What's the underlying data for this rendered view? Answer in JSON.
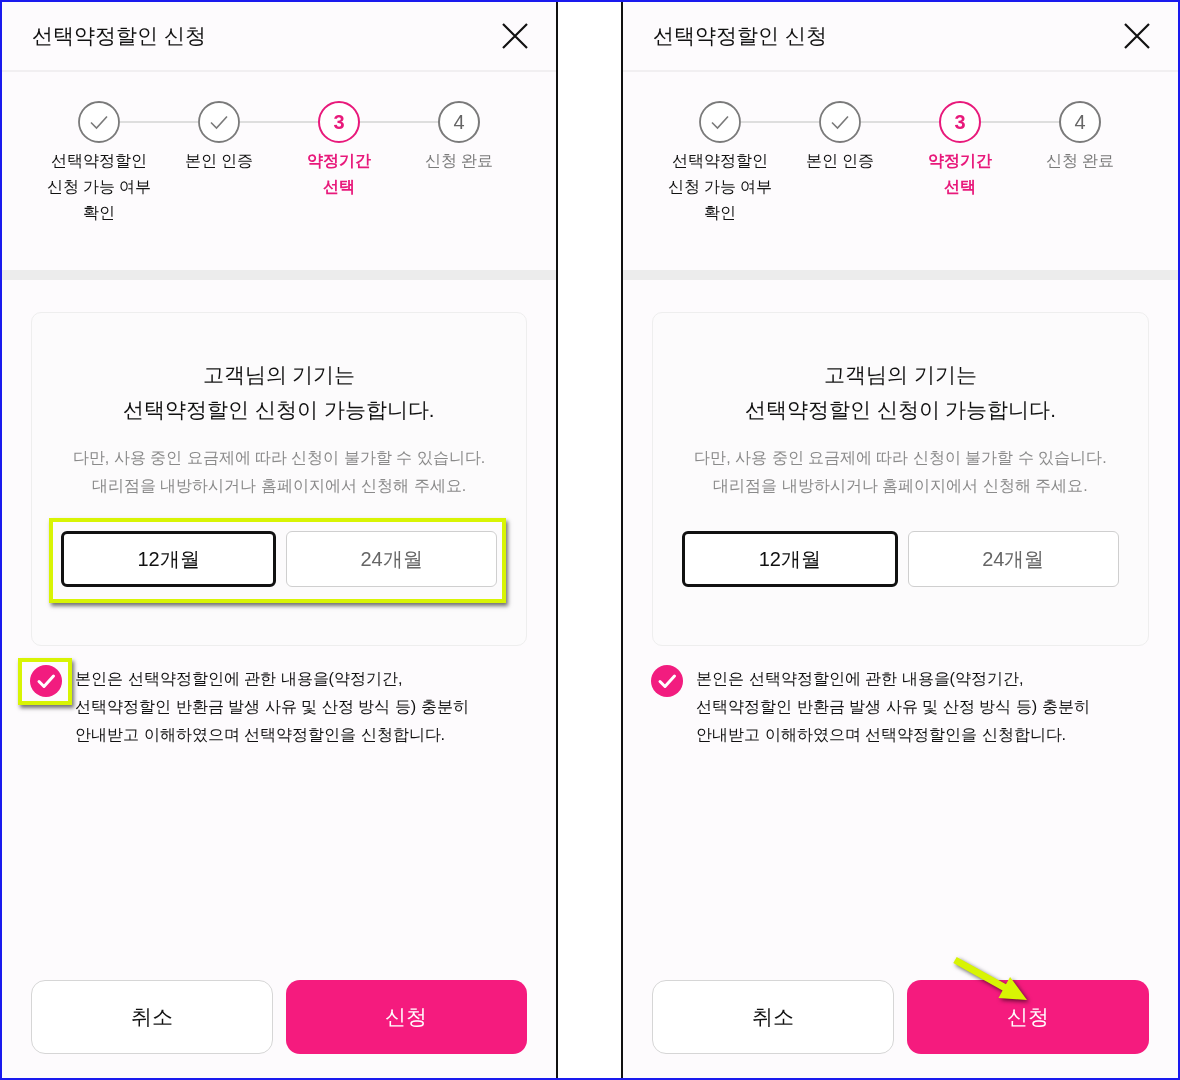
{
  "panels": [
    {
      "title": "선택약정할인 신청",
      "steps": [
        {
          "label": "선택약정할인\n신청 가능 여부\n확인",
          "completed": true,
          "active": false
        },
        {
          "label": "본인 인증",
          "completed": true,
          "active": false
        },
        {
          "number": "3",
          "label": "약정기간\n선택",
          "completed": false,
          "active": true
        },
        {
          "number": "4",
          "label": "신청 완료",
          "completed": false,
          "active": false
        }
      ],
      "card": {
        "title": "고객님의 기기는\n선택약정할인 신청이 가능합니다.",
        "notice": "다만, 사용 중인 요금제에 따라 신청이 불가할 수 있습니다.\n대리점을 내방하시거나 홈페이지에서 신청해 주세요.",
        "options_highlighted": true,
        "options": [
          {
            "label": "12개월",
            "selected": true
          },
          {
            "label": "24개월",
            "selected": false
          }
        ]
      },
      "agreement": {
        "checked": true,
        "highlighted": true,
        "text": "본인은 선택약정할인에 관한 내용을(약정기간,\n선택약정할인 반환금 발생 사유 및 산정 방식 등) 충분히\n안내받고 이해하였으며 선택약정할인을 신청합니다."
      },
      "buttons": [
        {
          "label": "취소",
          "kind": "cancel",
          "pointed_at": false
        },
        {
          "label": "신청",
          "kind": "submit",
          "pointed_at": false
        }
      ]
    },
    {
      "title": "선택약정할인 신청",
      "steps": [
        {
          "label": "선택약정할인\n신청 가능 여부\n확인",
          "completed": true,
          "active": false
        },
        {
          "label": "본인 인증",
          "completed": true,
          "active": false
        },
        {
          "number": "3",
          "label": "약정기간\n선택",
          "completed": false,
          "active": true
        },
        {
          "number": "4",
          "label": "신청 완료",
          "completed": false,
          "active": false
        }
      ],
      "card": {
        "title": "고객님의 기기는\n선택약정할인 신청이 가능합니다.",
        "notice": "다만, 사용 중인 요금제에 따라 신청이 불가할 수 있습니다.\n대리점을 내방하시거나 홈페이지에서 신청해 주세요.",
        "options_highlighted": false,
        "options": [
          {
            "label": "12개월",
            "selected": true
          },
          {
            "label": "24개월",
            "selected": false
          }
        ]
      },
      "agreement": {
        "checked": true,
        "highlighted": false,
        "text": "본인은 선택약정할인에 관한 내용을(약정기간,\n선택약정할인 반환금 발생 사유 및 산정 방식 등) 충분히\n안내받고 이해하였으며 선택약정할인을 신청합니다."
      },
      "buttons": [
        {
          "label": "취소",
          "kind": "cancel",
          "pointed_at": false
        },
        {
          "label": "신청",
          "kind": "submit",
          "pointed_at": true
        }
      ]
    }
  ]
}
